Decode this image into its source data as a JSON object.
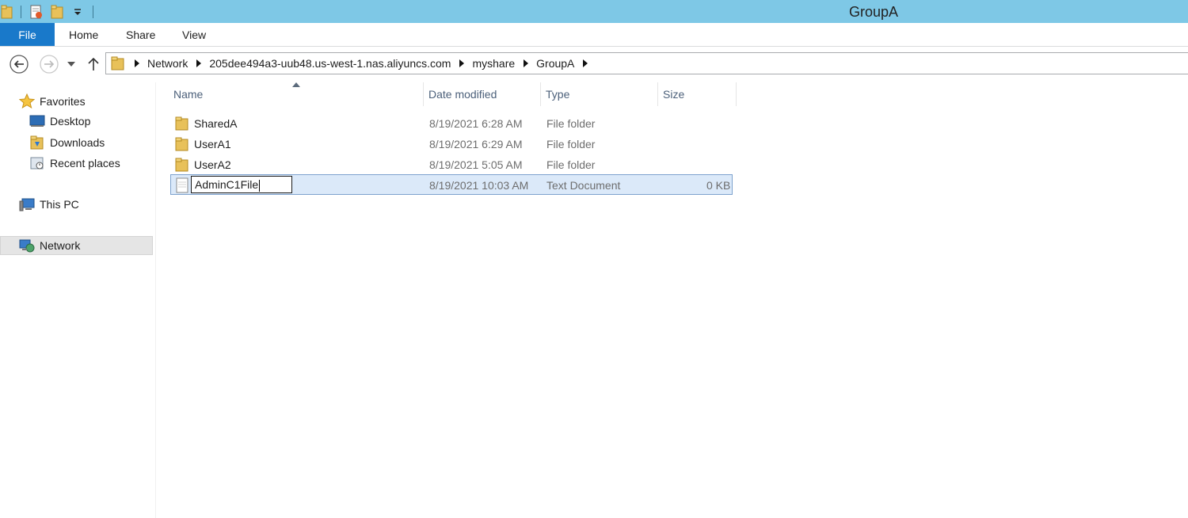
{
  "window": {
    "title": "GroupA"
  },
  "ribbon": {
    "tabs": [
      "File",
      "Home",
      "Share",
      "View"
    ]
  },
  "address": {
    "crumbs": [
      "Network",
      "205dee494a3-uub48.us-west-1.nas.aliyuncs.com",
      "myshare",
      "GroupA"
    ]
  },
  "sidebar": {
    "favorites": "Favorites",
    "favorite_items": [
      "Desktop",
      "Downloads",
      "Recent places"
    ],
    "this_pc": "This PC",
    "network": "Network"
  },
  "columns": {
    "name": "Name",
    "date": "Date modified",
    "type": "Type",
    "size": "Size"
  },
  "files": [
    {
      "name": "SharedA",
      "date": "8/19/2021 6:28 AM",
      "type": "File folder",
      "size": ""
    },
    {
      "name": "UserA1",
      "date": "8/19/2021 6:29 AM",
      "type": "File folder",
      "size": ""
    },
    {
      "name": "UserA2",
      "date": "8/19/2021 5:05 AM",
      "type": "File folder",
      "size": ""
    },
    {
      "name": "AdminC1File",
      "date": "8/19/2021 10:03 AM",
      "type": "Text Document",
      "size": "0 KB"
    }
  ],
  "colors": {
    "title_bar": "#7ec8e6",
    "file_tab": "#1979ca",
    "selection": "#dbe9f9"
  }
}
